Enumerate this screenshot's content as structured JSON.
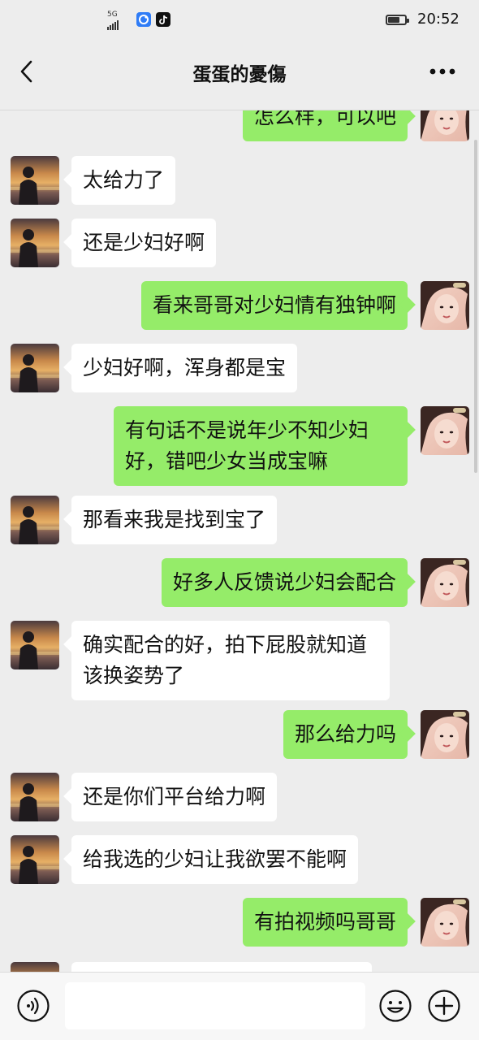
{
  "status_bar": {
    "network": "5G",
    "time": "20:52"
  },
  "header": {
    "title": "蛋蛋的憂傷"
  },
  "messages": [
    {
      "side": "right",
      "text": "怎么样，可以吧"
    },
    {
      "side": "left",
      "text": "太给力了"
    },
    {
      "side": "left",
      "text": "还是少妇好啊"
    },
    {
      "side": "right",
      "text": "看来哥哥对少妇情有独钟啊"
    },
    {
      "side": "left",
      "text": "少妇好啊，浑身都是宝"
    },
    {
      "side": "right",
      "text": "有句话不是说年少不知少妇好，错吧少女当成宝嘛"
    },
    {
      "side": "left",
      "text": "那看来我是找到宝了"
    },
    {
      "side": "right",
      "text": "好多人反馈说少妇会配合"
    },
    {
      "side": "left",
      "text": "确实配合的好，拍下屁股就知道该换姿势了"
    },
    {
      "side": "right",
      "text": "那么给力吗"
    },
    {
      "side": "left",
      "text": "还是你们平台给力啊"
    },
    {
      "side": "left",
      "text": "给我选的少妇让我欲罢不能啊"
    },
    {
      "side": "right",
      "text": "有拍视频吗哥哥"
    }
  ],
  "input_bar": {
    "text": ""
  },
  "icons": {
    "back": "chevron-left-icon",
    "more": "more-dots-icon",
    "voice": "voice-icon",
    "emoji": "emoji-icon",
    "plus": "plus-icon"
  },
  "colors": {
    "background": "#ededed",
    "sent_bubble": "#95ec69",
    "received_bubble": "#ffffff"
  }
}
